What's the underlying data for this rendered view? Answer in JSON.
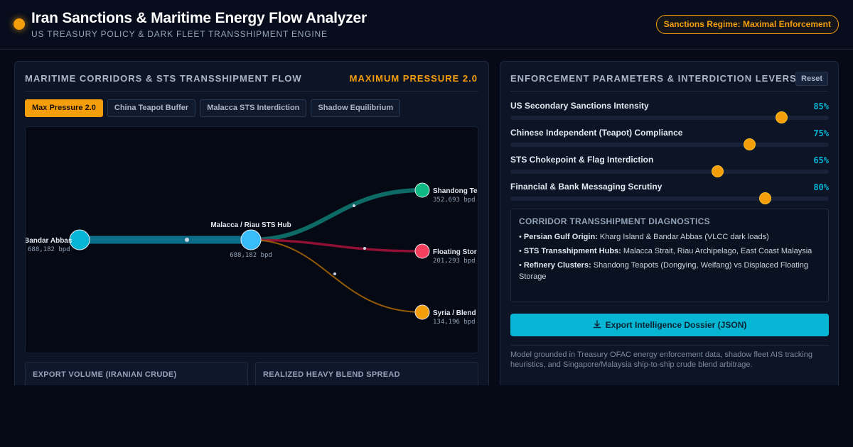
{
  "header": {
    "title": "Iran Sanctions & Maritime Energy Flow Analyzer",
    "subtitle": "US TREASURY POLICY & DARK FLEET TRANSSHIPMENT ENGINE",
    "badge": "Sanctions Regime: Maximal Enforcement",
    "accent_color": "#f59e0b"
  },
  "left_panel": {
    "title": "MARITIME CORRIDORS & STS TRANSSHIPMENT FLOW",
    "mode_label": "MAXIMUM PRESSURE 2.0",
    "tabs": [
      {
        "label": "Max Pressure 2.0",
        "active": true
      },
      {
        "label": "China Teapot Buffer",
        "active": false
      },
      {
        "label": "Malacca STS Interdiction",
        "active": false
      },
      {
        "label": "Shadow Equilibrium",
        "active": false
      }
    ],
    "flow": {
      "nodes": [
        {
          "id": "origin",
          "label": "Bandar Abbas",
          "value": "688,182 bpd",
          "color": "#06b6d4"
        },
        {
          "id": "hub",
          "label": "Malacca / Riau STS Hub",
          "value": "688,182 bpd",
          "color": "#38bdf8"
        },
        {
          "id": "shandong",
          "label": "Shandong Te",
          "value": "352,693 bpd",
          "color": "#10b981"
        },
        {
          "id": "floating",
          "label": "Floating Stor",
          "value": "201,293 bpd",
          "color": "#f43f5e"
        },
        {
          "id": "syria",
          "label": "Syria / Blend",
          "value": "134,196 bpd",
          "color": "#f59e0b"
        }
      ],
      "links": [
        {
          "from": "origin",
          "to": "hub",
          "bpd": 688182,
          "color": "#0e7490"
        },
        {
          "from": "hub",
          "to": "shandong",
          "bpd": 352693,
          "color": "#0f766e"
        },
        {
          "from": "hub",
          "to": "floating",
          "bpd": 201293,
          "color": "#9f1239"
        },
        {
          "from": "hub",
          "to": "syria",
          "bpd": 134196,
          "color": "#a16207"
        }
      ]
    },
    "metrics": [
      {
        "label": "EXPORT VOLUME (IRANIAN CRUDE)"
      },
      {
        "label": "REALIZED HEAVY BLEND SPREAD"
      }
    ]
  },
  "right_panel": {
    "title": "ENFORCEMENT PARAMETERS & INTERDICTION LEVERS",
    "reset_label": "Reset",
    "sliders": [
      {
        "label": "US Secondary Sanctions Intensity",
        "value_text": "85%",
        "value": 0.85
      },
      {
        "label": "Chinese Independent (Teapot) Compliance",
        "value_text": "75%",
        "value": 0.75
      },
      {
        "label": "STS Chokepoint & Flag Interdiction",
        "value_text": "65%",
        "value": 0.65
      },
      {
        "label": "Financial & Bank Messaging Scrutiny",
        "value_text": "80%",
        "value": 0.8
      }
    ],
    "diagnostics": {
      "title": "CORRIDOR TRANSSHIPMENT DIAGNOSTICS",
      "items": [
        {
          "key": "Persian Gulf Origin:",
          "text": "Kharg Island & Bandar Abbas (VLCC dark loads)"
        },
        {
          "key": "STS Transshipment Hubs:",
          "text": "Malacca Strait, Riau Archipelago, East Coast Malaysia"
        },
        {
          "key": "Refinery Clusters:",
          "text": "Shandong Teapots (Dongying, Weifang) vs Displaced Floating Storage"
        }
      ]
    },
    "export_label": "Export Intelligence Dossier (JSON)",
    "footnote": "Model grounded in Treasury OFAC energy enforcement data, shadow fleet AIS tracking heuristics, and Singapore/Malaysia ship-to-ship crude blend arbitrage."
  }
}
